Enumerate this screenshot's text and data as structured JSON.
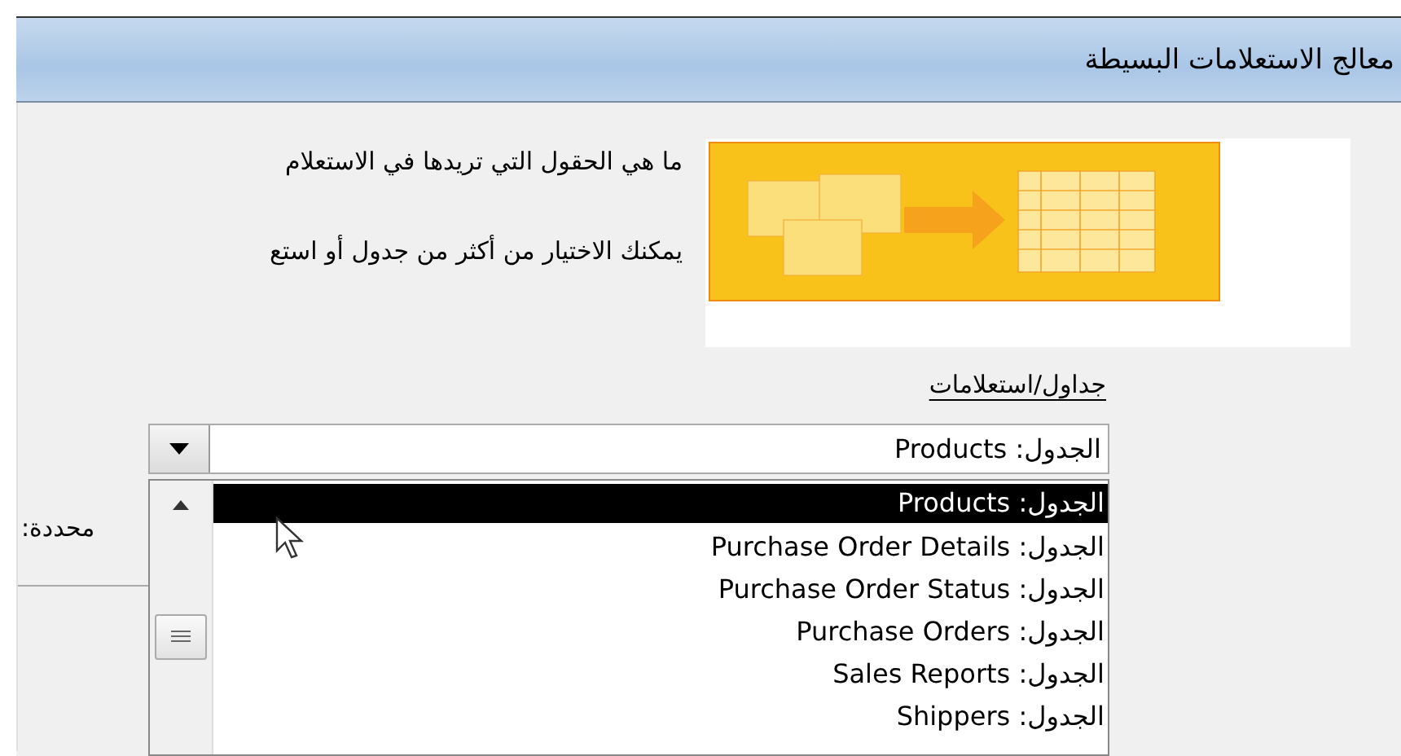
{
  "window": {
    "title": "معالج الاستعلامات البسيطة"
  },
  "intro": {
    "question": "ما هي الحقول التي تريدها في الاستعلام",
    "hint": "يمكنك الاختيار من أكثر من جدول أو استع"
  },
  "source": {
    "label": "جداول/استعلامات",
    "value": "الجدول: Products"
  },
  "selected_fields_label": "محددة:",
  "dropdown": {
    "items": [
      {
        "text": "الجدول: Products",
        "selected": true
      },
      {
        "text": "الجدول: Purchase Order Details",
        "selected": false
      },
      {
        "text": "الجدول: Purchase Order Status",
        "selected": false
      },
      {
        "text": "الجدول: Purchase Orders",
        "selected": false
      },
      {
        "text": "الجدول: Sales Reports",
        "selected": false
      },
      {
        "text": "الجدول: Shippers",
        "selected": false
      }
    ]
  }
}
